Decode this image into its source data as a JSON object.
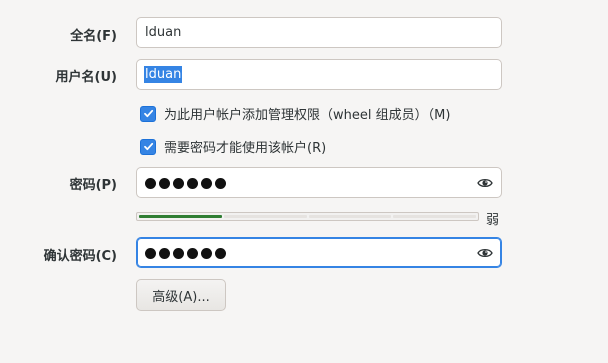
{
  "form": {
    "fullname_label": "全名(F)",
    "fullname_value": "lduan",
    "username_label": "用户名(U)",
    "username_value": "lduan",
    "admin_checkbox": {
      "label": "为此用户帐户添加管理权限（wheel 组成员）（M)",
      "checked": true
    },
    "require_password_checkbox": {
      "label": "需要密码才能使用该帐户(R)",
      "checked": true
    },
    "password_label": "密码(P)",
    "password_dots": 6,
    "password_strength": {
      "level": 0.25,
      "text": "弱",
      "color": "#2f7d32"
    },
    "confirm_label": "确认密码(C)",
    "confirm_dots": 6,
    "advanced_button": "高级(A)..."
  },
  "colors": {
    "accent": "#3584e4",
    "background": "#f6f5f4",
    "strength_fill": "#2f7d32"
  },
  "icons": {
    "reveal_password": "eye-icon",
    "checkmark": "checkmark-icon"
  }
}
